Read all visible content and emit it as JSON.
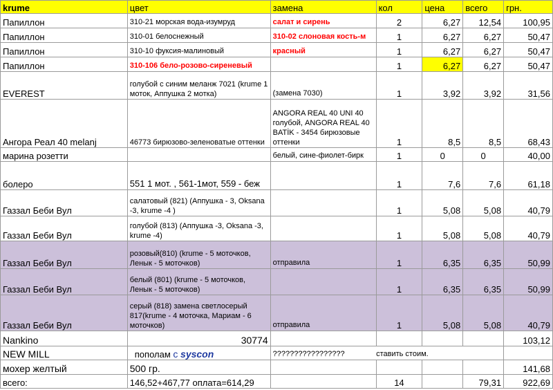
{
  "header": {
    "name": "krume",
    "color": "цвет",
    "replacement": "замена",
    "qty": "кол",
    "price": "цена",
    "total": "всего",
    "uah": "грн."
  },
  "rows": [
    {
      "name": "Папиллон",
      "color": "310-21 морская вода-изумруд",
      "replacement": "салат и сирень",
      "qty": "2",
      "price": "6,27",
      "total": "12,54",
      "uah": "100,95"
    },
    {
      "name": "Папиллон",
      "color": "310-01 белоснежный",
      "replacement": "310-02 слоновая кость-м",
      "qty": "1",
      "price": "6,27",
      "total": "6,27",
      "uah": "50,47"
    },
    {
      "name": "Папиллон",
      "color": "310-10 фуксия-малиновый",
      "replacement": "красный",
      "qty": "1",
      "price": "6,27",
      "total": "6,27",
      "uah": "50,47"
    },
    {
      "name": "Папиллон",
      "color": "310-106 бело-розово-сиреневый",
      "replacement": "",
      "qty": "1",
      "price": "6,27",
      "total": "6,27",
      "uah": "50,47"
    },
    {
      "name": "EVEREST",
      "color": "голубой с синим меланж 7021 (krume 1 моток, Аппушка 2 мотка)",
      "replacement": "(замена 7030)",
      "qty": "1",
      "price": "3,92",
      "total": "3,92",
      "uah": "31,56"
    },
    {
      "name": "Ангора Реал 40 melanj",
      "color": "46773 бирюзово-зеленоватые оттенки",
      "replacement": "ANGORA REAL 40 UNI 40 голубой, ANGORA REAL 40 BATİK - 3454 бирюзовые оттенки",
      "qty": "1",
      "price": "8,5",
      "total": "8,5",
      "uah": "68,43"
    },
    {
      "name": "марина розетти",
      "color": "",
      "replacement": "белый, сине-фиолет-бирк",
      "qty": "1",
      "price": "0",
      "total": "0",
      "uah": "40,00"
    },
    {
      "name": "болеро",
      "color": "551 1 мот. , 561-1мот, 559 - беж",
      "replacement": "",
      "qty": "1",
      "price": "7,6",
      "total": "7,6",
      "uah": "61,18"
    },
    {
      "name": "Газзал Беби Вул",
      "color": "салатовый (821) (Аппушка - 3, Oksana -3, krume -4 )",
      "replacement": "",
      "qty": "1",
      "price": "5,08",
      "total": "5,08",
      "uah": "40,79"
    },
    {
      "name": "Газзал Беби Вул",
      "color": "голубой (813) (Аппушка -3, Oksana -3, krume -4)",
      "replacement": "",
      "qty": "1",
      "price": "5,08",
      "total": "5,08",
      "uah": "40,79"
    },
    {
      "name": "Газзал Беби Вул",
      "color": "розовый(810) (krume - 5 моточков, Ленык - 5 моточков)",
      "replacement": "отправила",
      "qty": "1",
      "price": "6,35",
      "total": "6,35",
      "uah": "50,99"
    },
    {
      "name": "Газзал Беби Вул",
      "color": "белый (801) (krume - 5 моточков, Ленык - 5 моточков)",
      "replacement": "",
      "qty": "1",
      "price": "6,35",
      "total": "6,35",
      "uah": "50,99"
    },
    {
      "name": "Газзал Беби Вул",
      "color": "серый (818) замена светлосерый 817(krume - 4 моточка, Мариам - 6 моточков)",
      "replacement": "отправила",
      "qty": "1",
      "price": "5,08",
      "total": "5,08",
      "uah": "40,79"
    }
  ],
  "nankino": {
    "name": "Nankino",
    "number": "30774",
    "uah": "103,12"
  },
  "newmill": {
    "name": "NEW MILL",
    "text_a": "пополам",
    "text_c": "с",
    "syscon": "syscon",
    "question": "?????????????????",
    "tail": "ставить стоим."
  },
  "mohair": {
    "name": "мохер желтый",
    "amount": "500 гр.",
    "uah": "141,68"
  },
  "totals": {
    "label": "всего:",
    "formula": "146,52+467,77 оплата=614,29",
    "qty": "14",
    "total": "79,31",
    "uah": "922,69"
  }
}
